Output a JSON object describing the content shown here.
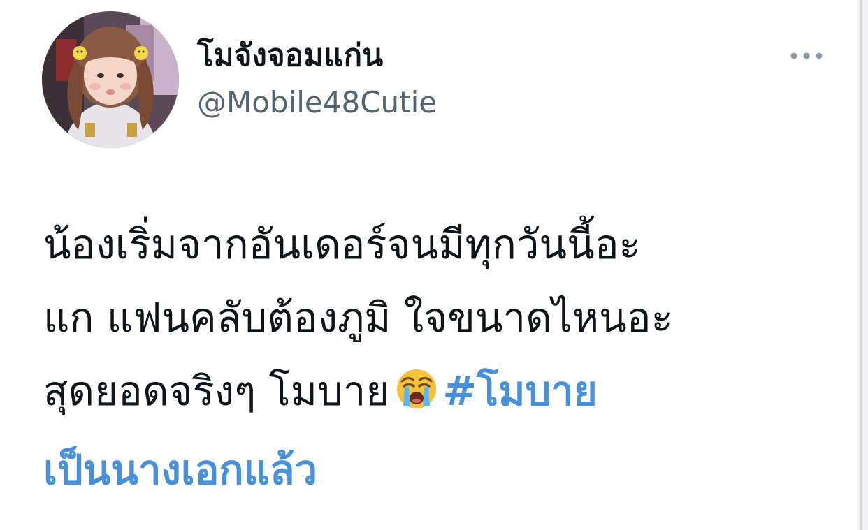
{
  "author": {
    "display_name": "โมจังจอมแก่น",
    "handle": "@Mobile48Cutie",
    "avatar_icon": "profile-photo"
  },
  "more_icon": "more-dots-icon",
  "tweet": {
    "line1": "น้องเริ่มจากอันเดอร์จนมีทุกวันนี้อะ",
    "line2": "แก แฟนคลับต้องภูมิ ใจขนาดไหนอะ",
    "line3_text": "สุดยอดจริงๆ โมบาย",
    "emoji_icon": "loudly-crying-face-emoji",
    "hashtag_part1": "#โมบาย",
    "hashtag_part2": "เป็นนางเอกแล้ว"
  },
  "colors": {
    "text": "#0f1419",
    "handle": "#536471",
    "hashtag": "#4a90d9"
  }
}
